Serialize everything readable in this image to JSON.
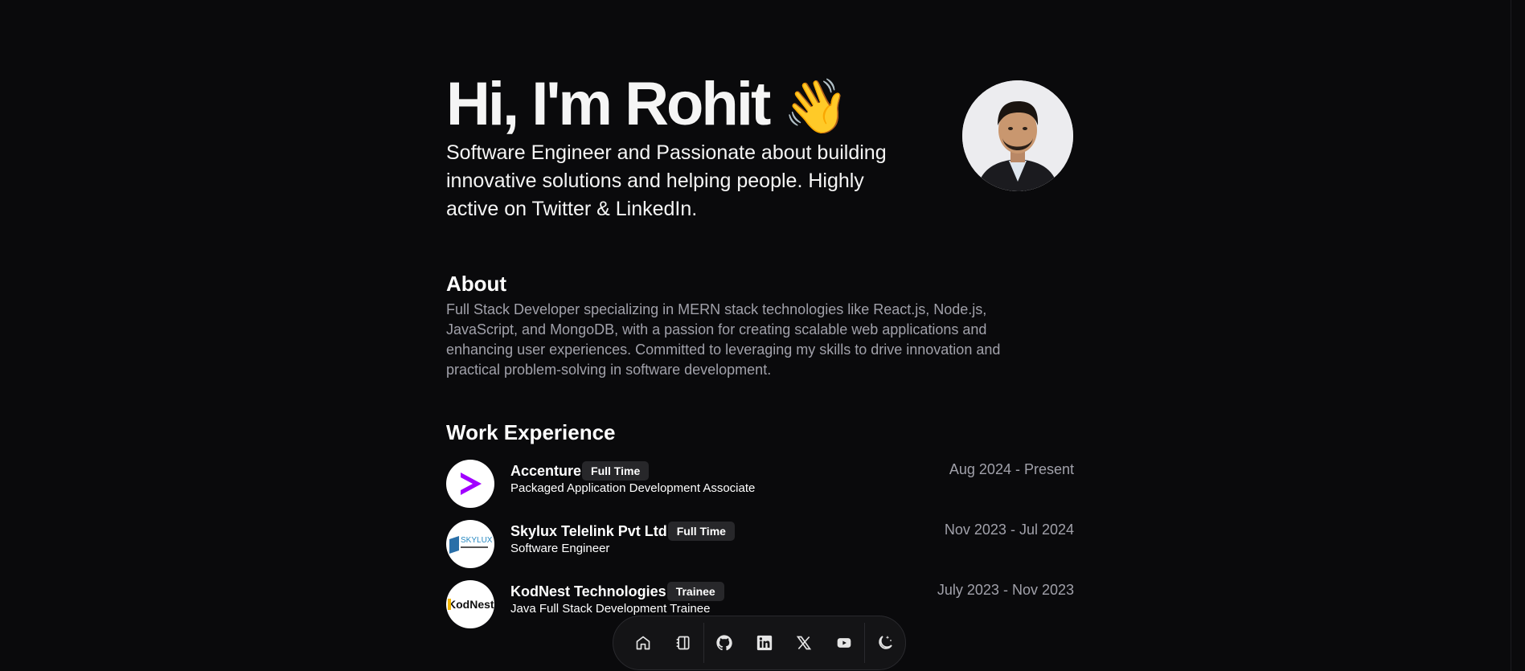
{
  "hero": {
    "title": "Hi, I'm Rohit",
    "wave": "👋",
    "subtitle": "Software Engineer and Passionate about building innovative solutions and helping people. Highly active on Twitter & LinkedIn."
  },
  "about": {
    "heading": "About",
    "text": "Full Stack Developer specializing in MERN stack technologies like React.js, Node.js, JavaScript, and MongoDB, with a passion for creating scalable web applications and enhancing user experiences. Committed to leveraging my skills to drive innovation and practical problem-solving in software development."
  },
  "work": {
    "heading": "Work Experience",
    "items": [
      {
        "company": "Accenture",
        "badge": "Full Time",
        "role": "Packaged Application Development Associate",
        "dates": "Aug 2024 - Present",
        "logo": "accenture-logo"
      },
      {
        "company": "Skylux Telelink Pvt Ltd",
        "badge": "Full Time",
        "role": "Software Engineer",
        "dates": "Nov 2023 - Jul 2024",
        "logo": "skylux-logo",
        "logo_text": "SKYLUX"
      },
      {
        "company": "KodNest Technologies",
        "badge": "Trainee",
        "role": "Java Full Stack Development Trainee",
        "dates": "July 2023 - Nov 2023",
        "logo": "kodnest-logo",
        "logo_text": "KodNest"
      }
    ]
  },
  "dock": {
    "items": [
      "home-icon",
      "notebook-icon",
      "github-icon",
      "linkedin-icon",
      "x-icon",
      "youtube-icon",
      "theme-toggle-icon"
    ]
  },
  "colors": {
    "background": "#0a0a0c",
    "muted_text": "#a1a1aa",
    "badge_bg": "#27272a",
    "accenture_purple": "#a100ff"
  }
}
